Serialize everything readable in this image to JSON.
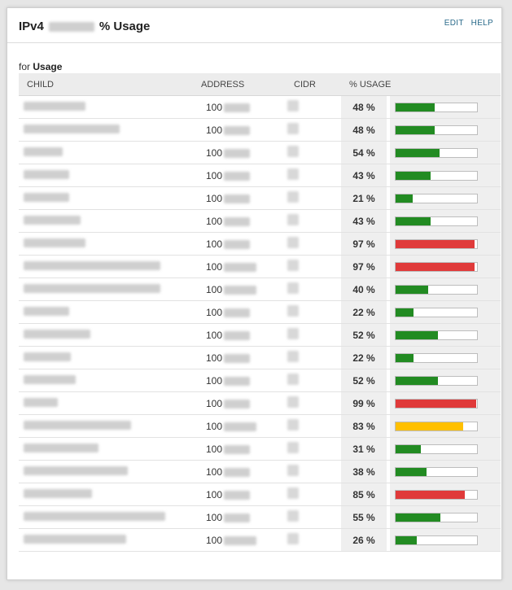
{
  "header": {
    "title_prefix": "IPv4",
    "title_suffix": "% Usage",
    "edit_label": "EDIT",
    "help_label": "HELP"
  },
  "subheader": {
    "for_label": "for",
    "for_value": "Usage"
  },
  "table": {
    "columns": [
      "CHILD",
      "ADDRESS",
      "CIDR",
      "% USAGE"
    ],
    "rows": [
      {
        "address_prefix": "100",
        "usage": "48 %",
        "usage_value": 48,
        "status": "ok"
      },
      {
        "address_prefix": "100",
        "usage": "48 %",
        "usage_value": 48,
        "status": "ok"
      },
      {
        "address_prefix": "100",
        "usage": "54 %",
        "usage_value": 54,
        "status": "ok"
      },
      {
        "address_prefix": "100",
        "usage": "43 %",
        "usage_value": 43,
        "status": "ok"
      },
      {
        "address_prefix": "100",
        "usage": "21 %",
        "usage_value": 21,
        "status": "ok"
      },
      {
        "address_prefix": "100",
        "usage": "43 %",
        "usage_value": 43,
        "status": "ok"
      },
      {
        "address_prefix": "100",
        "usage": "97 %",
        "usage_value": 97,
        "status": "critical"
      },
      {
        "address_prefix": "100",
        "usage": "97 %",
        "usage_value": 97,
        "status": "critical"
      },
      {
        "address_prefix": "100",
        "usage": "40 %",
        "usage_value": 40,
        "status": "ok"
      },
      {
        "address_prefix": "100",
        "usage": "22 %",
        "usage_value": 22,
        "status": "ok"
      },
      {
        "address_prefix": "100",
        "usage": "52 %",
        "usage_value": 52,
        "status": "ok"
      },
      {
        "address_prefix": "100",
        "usage": "22 %",
        "usage_value": 22,
        "status": "ok"
      },
      {
        "address_prefix": "100",
        "usage": "52 %",
        "usage_value": 52,
        "status": "ok"
      },
      {
        "address_prefix": "100",
        "usage": "99 %",
        "usage_value": 99,
        "status": "critical"
      },
      {
        "address_prefix": "100",
        "usage": "83 %",
        "usage_value": 83,
        "status": "warning"
      },
      {
        "address_prefix": "100",
        "usage": "31 %",
        "usage_value": 31,
        "status": "ok"
      },
      {
        "address_prefix": "100",
        "usage": "38 %",
        "usage_value": 38,
        "status": "ok"
      },
      {
        "address_prefix": "100",
        "usage": "85 %",
        "usage_value": 85,
        "status": "critical"
      },
      {
        "address_prefix": "100",
        "usage": "55 %",
        "usage_value": 55,
        "status": "ok"
      },
      {
        "address_prefix": "100",
        "usage": "26 %",
        "usage_value": 26,
        "status": "ok"
      }
    ]
  },
  "colors": {
    "ok": "#228b22",
    "warning": "#ffc000",
    "critical": "#e03a3a",
    "link": "#2a6a8a"
  }
}
